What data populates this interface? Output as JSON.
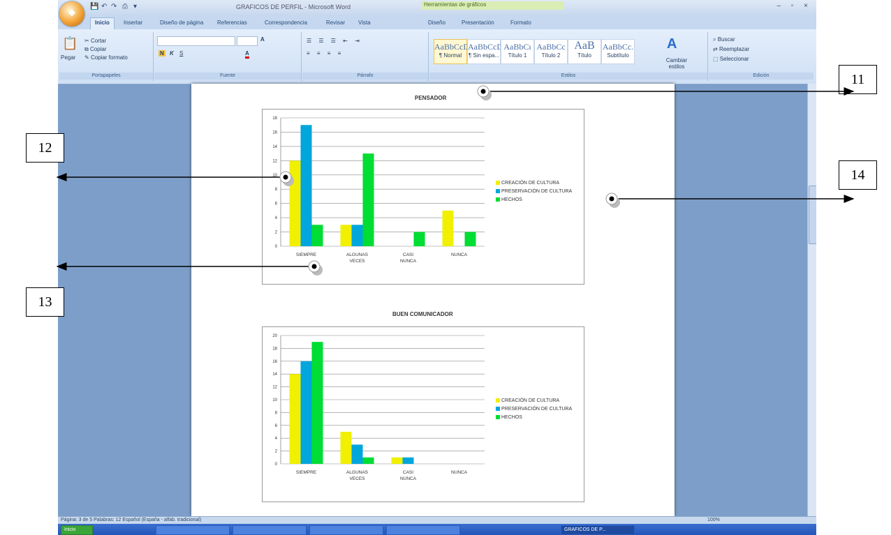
{
  "window": {
    "title": "GRAFICOS DE PERFIL - Microsoft Word",
    "context_tab": "Herramientas de gráficos",
    "controls": "–  ▫  ×"
  },
  "ribbon": {
    "tabs": [
      "Inicio",
      "Insertar",
      "Diseño de página",
      "Referencias",
      "Correspondencia",
      "Revisar",
      "Vista",
      "Diseño",
      "Presentación",
      "Formato"
    ],
    "clipboard": {
      "paste": "Pegar",
      "cut": "Cortar",
      "copy": "Copiar",
      "format_painter": "Copiar formato",
      "label": "Portapapeles"
    },
    "font": {
      "label": "Fuente",
      "bold": "N",
      "italic": "K",
      "underline": "S",
      "grow": "A",
      "text_color": "A"
    },
    "paragraph": {
      "label": "Párrafo"
    },
    "styles": {
      "label": "Estilos",
      "items": [
        {
          "sample": "AaBbCcDı",
          "name": "¶ Normal"
        },
        {
          "sample": "AaBbCcDı",
          "name": "¶ Sin espa..."
        },
        {
          "sample": "AaBbCı",
          "name": "Título 1"
        },
        {
          "sample": "AaBbCc",
          "name": "Título 2"
        },
        {
          "sample": "AaB",
          "name": "Título"
        },
        {
          "sample": "AaBbCc.",
          "name": "Subtítulo"
        }
      ],
      "change": "Cambiar estilos"
    },
    "editing": {
      "label": "Edición",
      "find": "Buscar",
      "replace": "Reemplazar",
      "select": "Seleccionar"
    }
  },
  "charts": [
    {
      "title": "PENSADOR",
      "chart_data": {
        "type": "bar",
        "categories": [
          "SIEMPRE",
          "ALGUNAS VECES",
          "CASI NUNCA",
          "NUNCA"
        ],
        "series": [
          {
            "name": "CREACIÓN DE CULTURA",
            "color": "#f0f000",
            "values": [
              12,
              3,
              0,
              5
            ]
          },
          {
            "name": "PRESERVACIÓN DE CULTURA",
            "color": "#00a6dc",
            "values": [
              17,
              3,
              0,
              0
            ]
          },
          {
            "name": "HECHOS",
            "color": "#00dd33",
            "values": [
              3,
              13,
              2,
              2
            ]
          }
        ],
        "ylim": [
          0,
          18
        ],
        "yticks": [
          0,
          2,
          4,
          6,
          8,
          10,
          12,
          14,
          16,
          18
        ],
        "grid": true,
        "legend": "right"
      }
    },
    {
      "title": "BUEN COMUNICADOR",
      "chart_data": {
        "type": "bar",
        "categories": [
          "SIEMPRE",
          "ALGUNAS VECES",
          "CASI NUNCA",
          "NUNCA"
        ],
        "series": [
          {
            "name": "CREACIÓN DE CULTURA",
            "color": "#f0f000",
            "values": [
              14,
              5,
              1,
              0
            ]
          },
          {
            "name": "PRESERVACIÓN DE CULTURA",
            "color": "#00a6dc",
            "values": [
              16,
              3,
              1,
              0
            ]
          },
          {
            "name": "HECHOS",
            "color": "#00dd33",
            "values": [
              19,
              1,
              0,
              0
            ]
          }
        ],
        "ylim": [
          0,
          20
        ],
        "yticks": [
          0,
          2,
          4,
          6,
          8,
          10,
          12,
          14,
          16,
          18,
          20
        ],
        "grid": true,
        "legend": "right"
      }
    }
  ],
  "callouts": [
    "11",
    "12",
    "13",
    "14"
  ],
  "statusbar": {
    "text": "Página: 3 de 5   Palabras: 12   Español (España - alfab. tradicional)",
    "zoom": "100%"
  },
  "taskbar": {
    "items": [
      "Inicio",
      "",
      "",
      "",
      "",
      "GRAFICOS DE P..."
    ]
  }
}
